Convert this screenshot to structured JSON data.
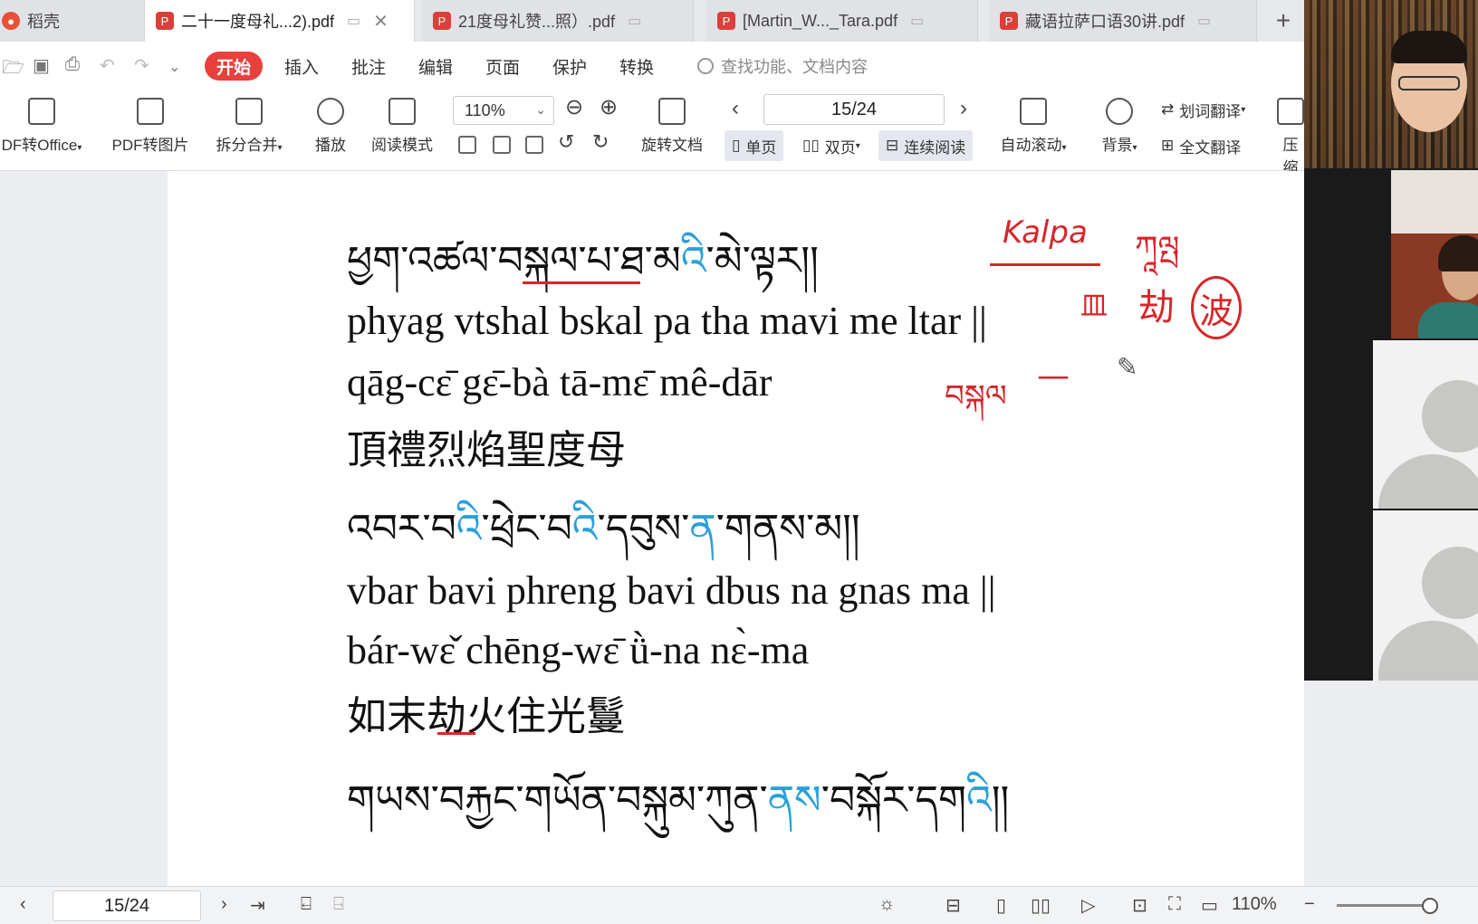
{
  "tabs": [
    {
      "label": "稻壳",
      "active": false
    },
    {
      "label": "二十一度母礼...2).pdf",
      "active": true
    },
    {
      "label": "21度母礼赞...照）.pdf",
      "active": false
    },
    {
      "label": "[Martin_W..._Tara.pdf",
      "active": false
    },
    {
      "label": "藏语拉萨口语30讲.pdf",
      "active": false
    }
  ],
  "new_tab": "+",
  "menu": {
    "start": "开始",
    "items": [
      "插入",
      "批注",
      "编辑",
      "页面",
      "保护",
      "转换"
    ],
    "search_placeholder": "查找功能、文档内容"
  },
  "ribbon": {
    "pdf_to_office": "DF转Office",
    "pdf_to_image": "PDF转图片",
    "split_merge": "拆分合并",
    "play": "播放",
    "read_mode": "阅读模式",
    "zoom": "110%",
    "rotate_doc": "旋转文档",
    "page_indicator": "15/24",
    "single_page": "单页",
    "double_page": "双页",
    "continuous": "连续阅读",
    "auto_scroll": "自动滚动",
    "background": "背景",
    "word_translate": "划词翻译",
    "full_translate": "全文翻译",
    "compress": "压缩"
  },
  "document": {
    "lines": [
      {
        "type": "tib",
        "segments": [
          {
            "t": "ཕྱག་འཚལ་བསྐལ་པ་ཐ་མ"
          },
          {
            "t": "འི",
            "hl": true
          },
          {
            "t": "་མེ་ལྟར།།"
          }
        ]
      },
      {
        "type": "lat",
        "segments": [
          {
            "t": "phyag vtshal bskal pa tha mavi me ltar ||"
          }
        ]
      },
      {
        "type": "lat",
        "segments": [
          {
            "t": "qāg-cɛ̄ gɛ̄-bà tā-mɛ̄ mê-dār"
          }
        ]
      },
      {
        "type": "zh",
        "segments": [
          {
            "t": "頂禮烈焰聖度母"
          }
        ]
      },
      {
        "type": "tib",
        "segments": [
          {
            "t": "འབར་བ"
          },
          {
            "t": "འི",
            "hl": true
          },
          {
            "t": "་ཕྲེང་བ"
          },
          {
            "t": "འི",
            "hl": true
          },
          {
            "t": "་དབུས་"
          },
          {
            "t": "ན",
            "hl": true
          },
          {
            "t": "་གནས་མ།།"
          }
        ]
      },
      {
        "type": "lat",
        "segments": [
          {
            "t": "vbar bavi phreng bavi dbus na gnas ma ||"
          }
        ]
      },
      {
        "type": "lat",
        "segments": [
          {
            "t": "bár-wɛ̌ chēng-wɛ̄ ǜ-na nɛ̀-ma"
          }
        ]
      },
      {
        "type": "zh",
        "segments": [
          {
            "t": "如末劫火住光鬘"
          }
        ]
      },
      {
        "type": "tib",
        "segments": [
          {
            "t": "གཡས་བརྐྱང་གཡོན་བསྐུམ་ཀུན་"
          },
          {
            "t": "ནས",
            "hl": true
          },
          {
            "t": "་བསྐོར་དག"
          },
          {
            "t": "འི",
            "hl": true
          },
          {
            "t": "།།"
          }
        ]
      }
    ],
    "annotations": {
      "kalpa": "Kalpa",
      "kalpa_tib": "ཀཱལྤ",
      "chinese_char": "劫",
      "circled_char": "波",
      "left_char": "皿",
      "bskal": "བསྐལ",
      "dash": "—"
    }
  },
  "status": {
    "page": "15/24",
    "zoom": "110%"
  },
  "colors": {
    "accent_red": "#e8403a",
    "tibetan_highlight": "#2aa0d8",
    "ink_annotation": "#d6262a"
  }
}
